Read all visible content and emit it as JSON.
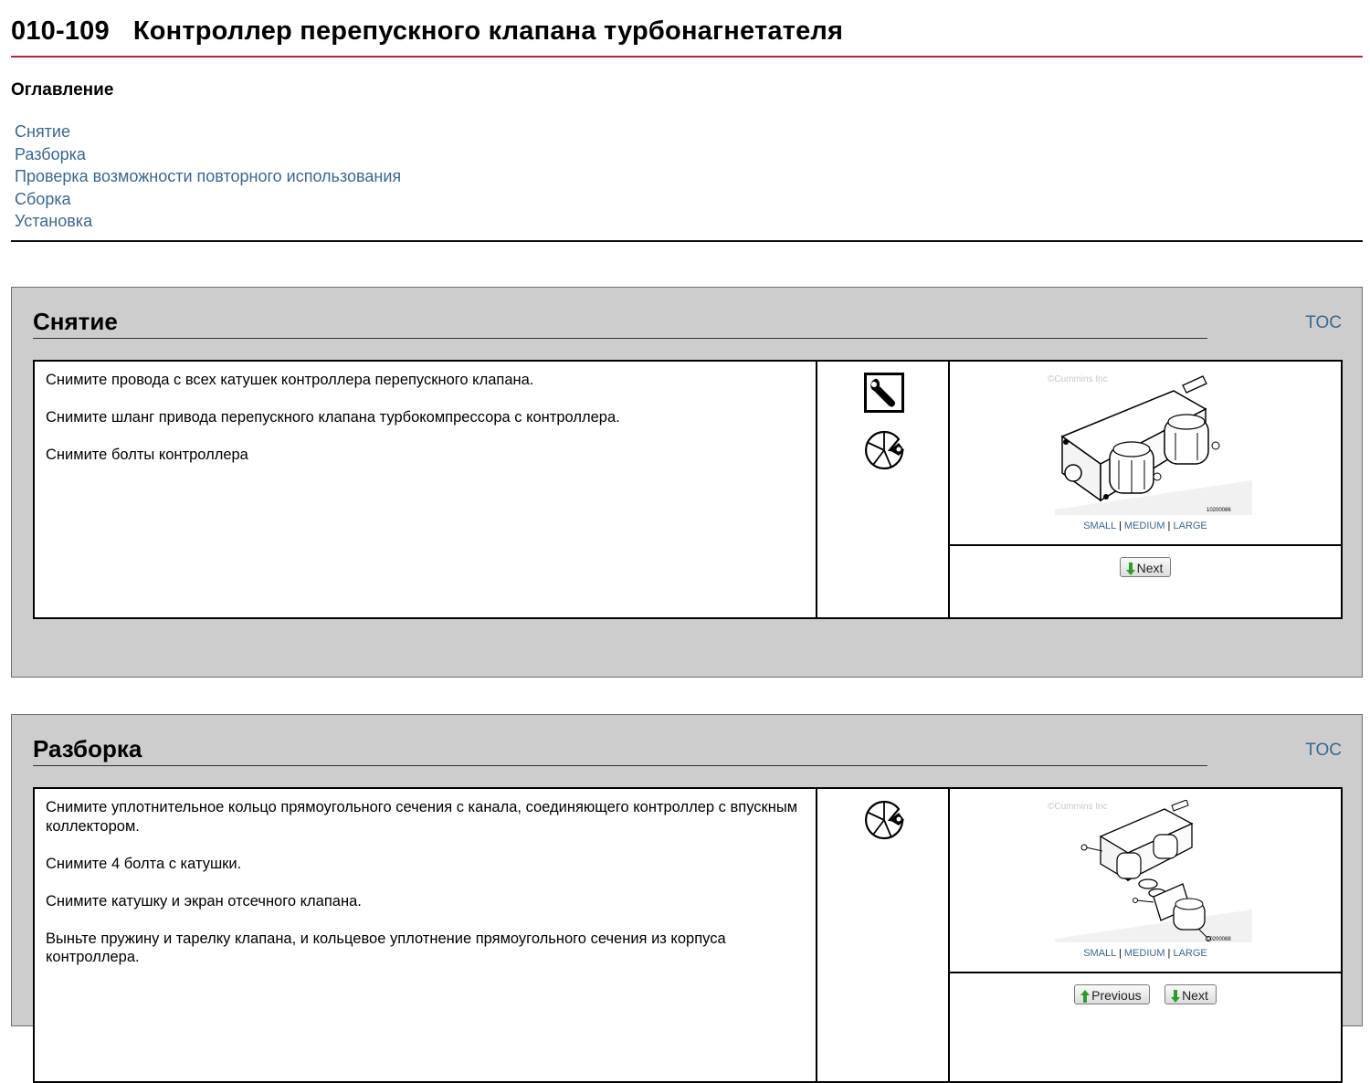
{
  "document": {
    "code": "010-109",
    "title": "Контроллер перепускного клапана турбонагнетателя"
  },
  "toc": {
    "heading": "Оглавление",
    "items": [
      "Снятие",
      "Разборка",
      "Проверка возможности повторного использования",
      "Сборка",
      "Установка"
    ]
  },
  "sections": [
    {
      "title": "Снятие",
      "toc_label": "TOC",
      "steps": [
        "Снимите провода с всех катушек контроллера перепускного клапана.",
        "Снимите шланг привода перепускного клапана турбокомпрессора с контроллера.",
        "Снимите болты контроллера"
      ],
      "icons": [
        "wrench-icon",
        "pie-chart-icon"
      ],
      "image": {
        "watermark": "©Cummins Inc",
        "fig_number": "10200086",
        "sizes": [
          "SMALL",
          "MEDIUM",
          "LARGE"
        ]
      },
      "nav": {
        "next": "Next"
      }
    },
    {
      "title": "Разборка",
      "toc_label": "TOC",
      "steps": [
        "Снимите уплотнительное кольцо прямоугольного сечения с канала, соединяющего контроллер с впускным коллектором.",
        "Снимите 4 болта с катушки.",
        "Снимите катушку и экран отсечного клапана.",
        "Выньте пружину и тарелку клапана, и кольцевое уплотнение прямоугольного сечения из корпуса контроллера."
      ],
      "icons": [
        "pie-chart-icon"
      ],
      "image": {
        "watermark": "©Cummins Inc",
        "fig_number": "10200088",
        "sizes": [
          "SMALL",
          "MEDIUM",
          "LARGE"
        ]
      },
      "nav": {
        "previous": "Previous",
        "next": "Next"
      }
    }
  ]
}
